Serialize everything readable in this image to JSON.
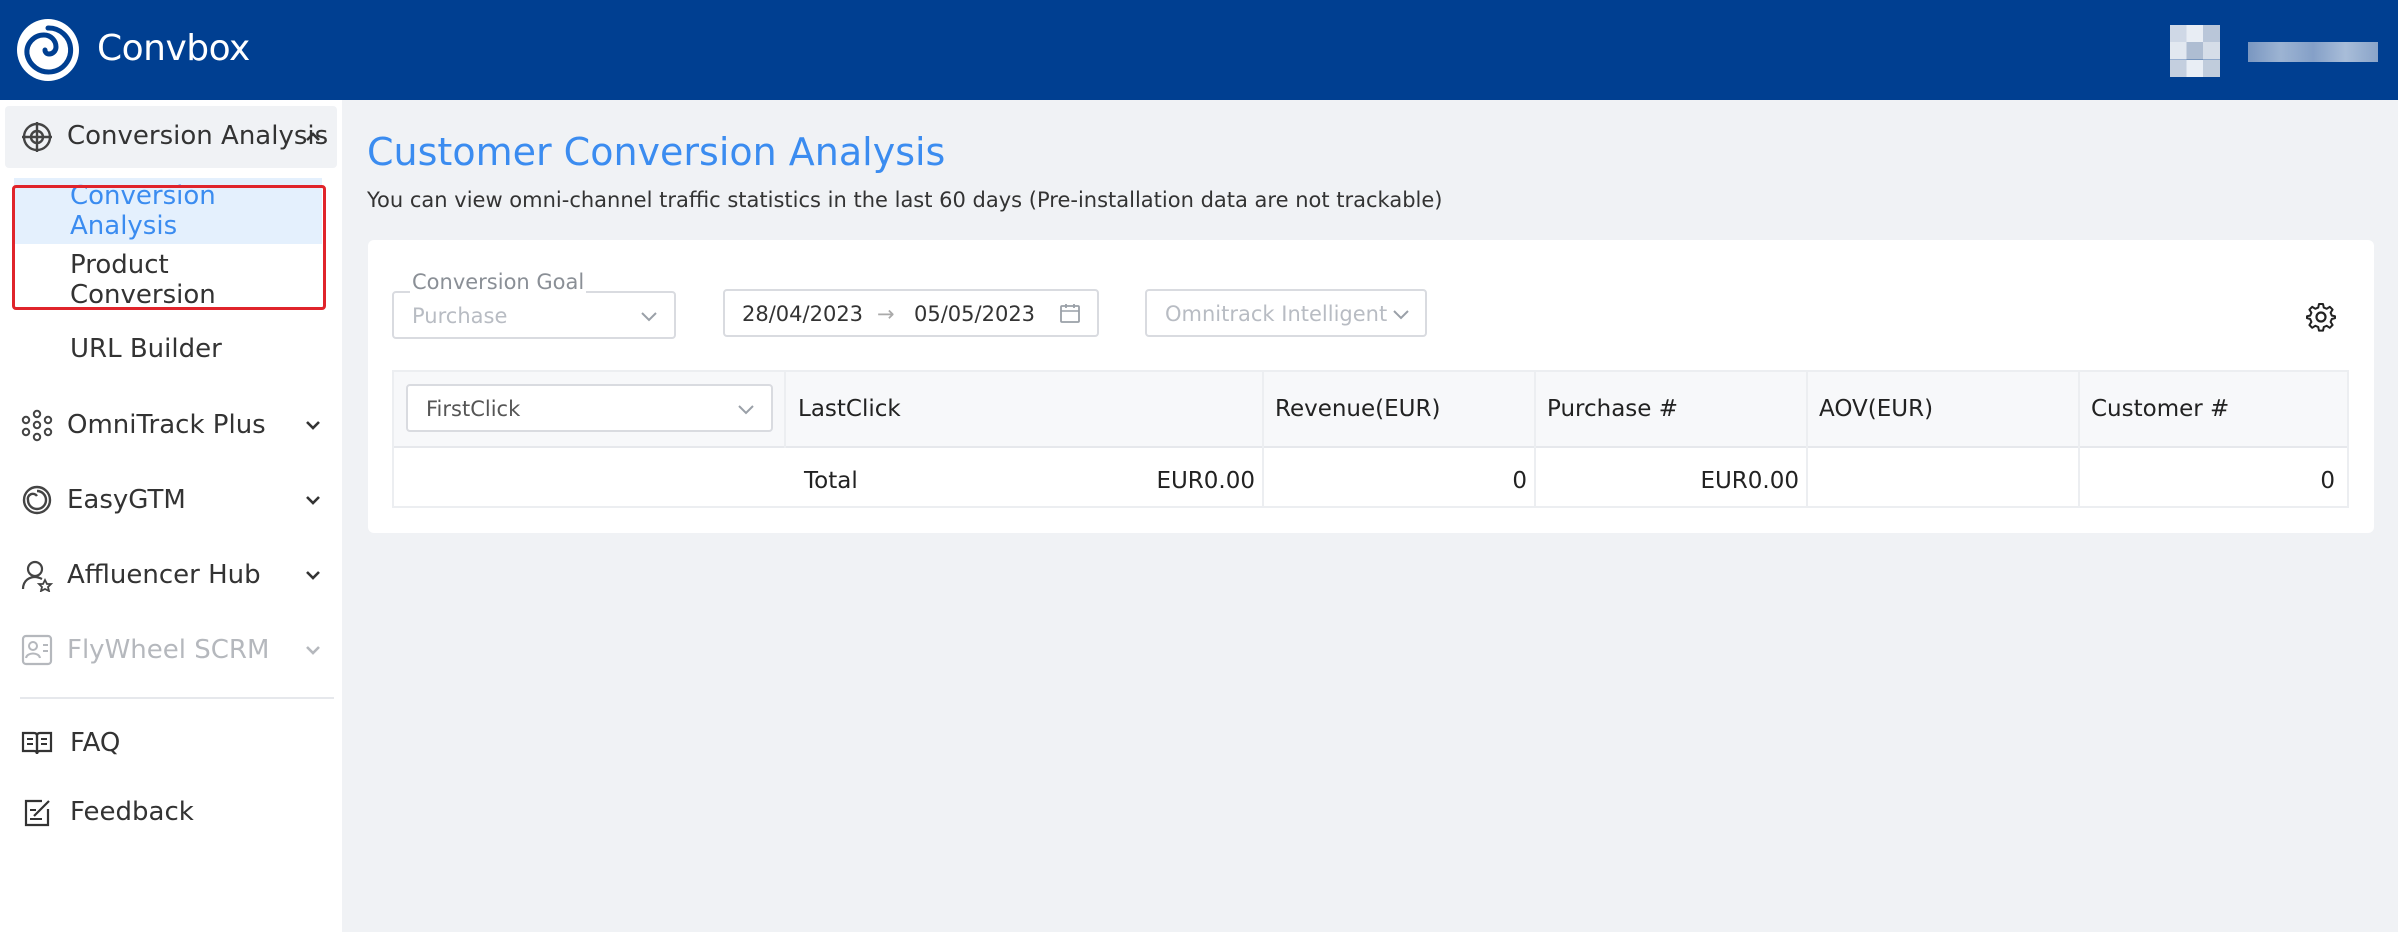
{
  "app": {
    "brand": "Convbox"
  },
  "sidebar": {
    "group": {
      "label": "Conversion Analysis",
      "icon": "crosshair-icon"
    },
    "subitems": [
      {
        "label": "Conversion Analysis",
        "active": true
      },
      {
        "label": "Product Conversion",
        "active": false
      },
      {
        "label": "URL Builder",
        "active": false
      }
    ],
    "items": [
      {
        "label": "OmniTrack Plus",
        "icon": "nodes-icon"
      },
      {
        "label": "EasyGTM",
        "icon": "spiral-icon"
      },
      {
        "label": "Affluencer Hub",
        "icon": "user-badge-icon"
      },
      {
        "label": "FlyWheel SCRM",
        "icon": "contact-card-icon",
        "disabled": true
      }
    ],
    "footer": [
      {
        "label": "FAQ",
        "icon": "book-icon"
      },
      {
        "label": "Feedback",
        "icon": "edit-note-icon"
      }
    ]
  },
  "page": {
    "title": "Customer Conversion Analysis",
    "subtitle": "You can view omni-channel traffic statistics in the last 60 days (Pre-installation data are not trackable)"
  },
  "filters": {
    "goal_label": "Conversion Goal",
    "goal_value": "Purchase",
    "date_start": "28/04/2023",
    "date_arrow": "→",
    "date_end": "05/05/2023",
    "attribution_value": "Omnitrack Intelligent"
  },
  "table": {
    "firstclick": "FirstClick",
    "headers": [
      "LastClick",
      "Revenue(EUR)",
      "Purchase #",
      "AOV(EUR)",
      "Customer #"
    ],
    "total_label": "Total",
    "total": {
      "revenue": "EUR0.00",
      "purchase": "0",
      "aov": "EUR0.00",
      "customer": "0"
    }
  },
  "colors": {
    "header_bg": "#003f91",
    "accent": "#3b8cf0",
    "highlight": "#e0242b"
  }
}
